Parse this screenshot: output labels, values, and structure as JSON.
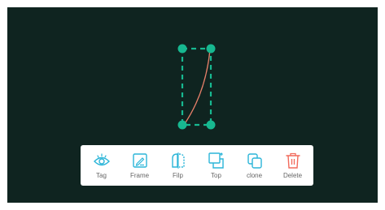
{
  "colors": {
    "canvas_bg": "#0f2420",
    "selection": "#17b890",
    "curve": "#e8806a",
    "toolbar_bg": "#ffffff",
    "icon_accent": "#2bb5d8",
    "label_color": "#666666",
    "delete_color": "#f26a5b"
  },
  "toolbar": {
    "items": [
      {
        "label": "Tag",
        "icon": "eye-icon"
      },
      {
        "label": "Frame",
        "icon": "frame-icon"
      },
      {
        "label": "Filp",
        "icon": "flip-icon"
      },
      {
        "label": "Top",
        "icon": "bring-to-top-icon"
      },
      {
        "label": "clone",
        "icon": "clone-icon"
      },
      {
        "label": "Delete",
        "icon": "trash-icon"
      }
    ]
  }
}
